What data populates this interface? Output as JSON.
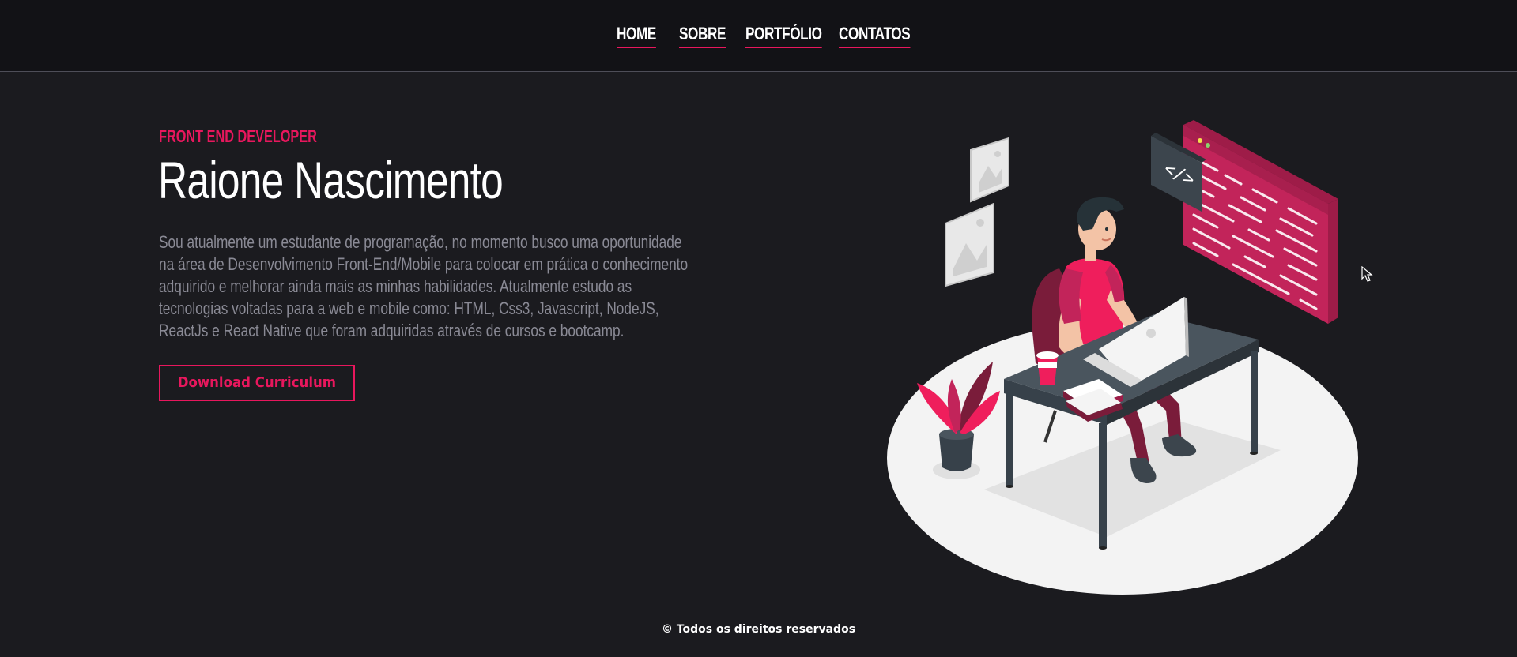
{
  "nav": {
    "items": [
      {
        "label": "HOME"
      },
      {
        "label": "SOBRE"
      },
      {
        "label": "PORTFÓLIO"
      },
      {
        "label": "CONTATOS"
      }
    ]
  },
  "hero": {
    "eyebrow": "FRONT END DEVELOPER",
    "name": "Raione Nascimento",
    "bio": "Sou atualmente um estudante de programação, no momento busco uma oportunidade na área de Desenvolvimento Front-End/Mobile para colocar em prática o conhecimento adquirido e melhorar ainda mais as minhas habilidades. Atualmente estudo as tecnologias voltadas para a web e mobile como: HTML, Css3, Javascript, NodeJS, ReactJs e React Native que foram adquiridas através de cursos e bootcamp.",
    "button_label": "Download Curriculum",
    "illustration_icon": "developer-at-desk-illustration",
    "code_symbol": "</>"
  },
  "footer": {
    "text": "© Todos os direitos reservados"
  },
  "colors": {
    "accent": "#e8175d",
    "background": "#1b1b1f",
    "nav_background": "#121216",
    "muted_text": "#8a8a95"
  }
}
